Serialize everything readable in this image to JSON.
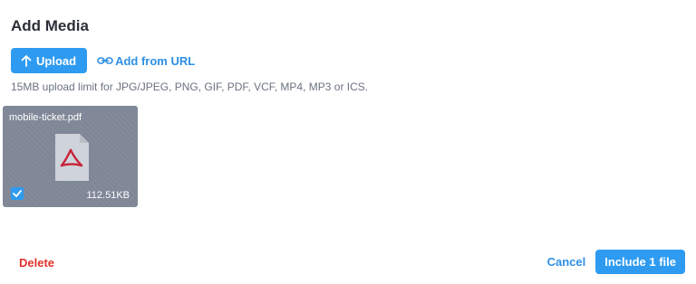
{
  "dialog": {
    "title": "Add Media"
  },
  "toolbar": {
    "upload_label": "Upload",
    "upload_icon": "arrow-up-icon",
    "add_url_label": "Add from URL",
    "add_url_icon": "link-icon"
  },
  "limit_text": "15MB upload limit for JPG/JPEG, PNG, GIF, PDF, VCF, MP4, MP3 or ICS.",
  "files": [
    {
      "name": "mobile-ticket.pdf",
      "size": "112.51KB",
      "icon": "pdf-icon",
      "selected": true
    }
  ],
  "footer": {
    "delete_label": "Delete",
    "cancel_label": "Cancel",
    "include_label": "Include 1 file"
  },
  "colors": {
    "accent": "#2e9bf0",
    "link": "#2e8fe6",
    "danger": "#e0312b",
    "card_bg": "#7f8797",
    "pdf_red": "#c8223a"
  }
}
